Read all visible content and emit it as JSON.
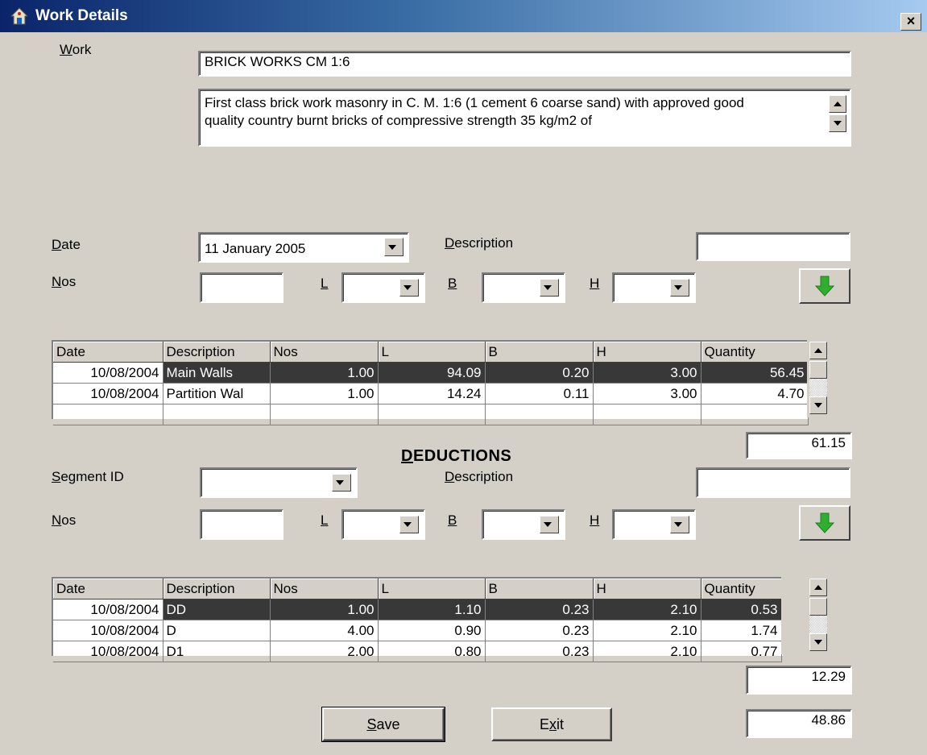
{
  "window": {
    "title": "Work Details",
    "icon": "app-house-icon",
    "close_label": "×"
  },
  "work": {
    "label_u": "W",
    "label_rest": "ork",
    "name_value": "BRICK WORKS CM 1:6",
    "description_value": "First class brick work masonry in C. M. 1:6 (1 cement 6 coarse sand) with approved good quality country burnt bricks of compressive strength 35 kg/m2 of"
  },
  "measurement": {
    "date_label_u": "D",
    "date_label_rest": "ate",
    "date_value": "11  January  2005",
    "description_label_pre": "",
    "description_label_u": "D",
    "description_label_rest": "escription",
    "description_value": "",
    "nos_label_u": "N",
    "nos_label_rest": "os",
    "nos_value": "",
    "l_label": "L",
    "b_label": "B",
    "h_label": "H",
    "l_value": "",
    "b_value": "",
    "h_value": "",
    "add_icon": "green-down-arrow-icon"
  },
  "measurements_grid": {
    "columns": [
      "Date",
      "Description",
      "Nos",
      "L",
      "B",
      "H",
      "Quantity"
    ],
    "rows": [
      {
        "date": "10/08/2004",
        "description": "Main Walls",
        "nos": "1.00",
        "l": "94.09",
        "b": "0.20",
        "h": "3.00",
        "quantity": "56.45",
        "selected": true
      },
      {
        "date": "10/08/2004",
        "description": "Partition Wal",
        "nos": "1.00",
        "l": "14.24",
        "b": "0.11",
        "h": "3.00",
        "quantity": "4.70",
        "selected": false
      },
      {
        "date": "",
        "description": "",
        "nos": "",
        "l": "",
        "b": "",
        "h": "",
        "quantity": "",
        "selected": false
      }
    ],
    "total": "61.15"
  },
  "deductions": {
    "heading_u": "D",
    "heading_rest": "EDUCTIONS",
    "segment_label_u": "S",
    "segment_label_rest": "egment ID",
    "segment_value": "",
    "description_label_u": "D",
    "description_label_rest": "escription",
    "description_value": "",
    "nos_label_u": "N",
    "nos_label_rest": "os",
    "nos_value": "",
    "l_label": "L",
    "b_label": "B",
    "h_label": "H",
    "add_icon": "green-down-arrow-icon"
  },
  "deductions_grid": {
    "columns": [
      "Date",
      "Description",
      "Nos",
      "L",
      "B",
      "H",
      "Quantity"
    ],
    "rows": [
      {
        "date": "10/08/2004",
        "description": "DD",
        "nos": "1.00",
        "l": "1.10",
        "b": "0.23",
        "h": "2.10",
        "quantity": "0.53",
        "selected": true
      },
      {
        "date": "10/08/2004",
        "description": "D",
        "nos": "4.00",
        "l": "0.90",
        "b": "0.23",
        "h": "2.10",
        "quantity": "1.74",
        "selected": false
      },
      {
        "date": "10/08/2004",
        "description": "D1",
        "nos": "2.00",
        "l": "0.80",
        "b": "0.23",
        "h": "2.10",
        "quantity": "0.77",
        "selected": false
      }
    ],
    "total": "12.29"
  },
  "net_total": "48.86",
  "buttons": {
    "save_u": "S",
    "save_rest": "ave",
    "exit_pre": "E",
    "exit_u": "x",
    "exit_rest": "it"
  },
  "colors": {
    "titlebar_start": "#0a246a",
    "titlebar_end": "#a6caf0",
    "face": "#d4d0c8",
    "selection": "#383838",
    "add_arrow": "#2fae2f"
  }
}
